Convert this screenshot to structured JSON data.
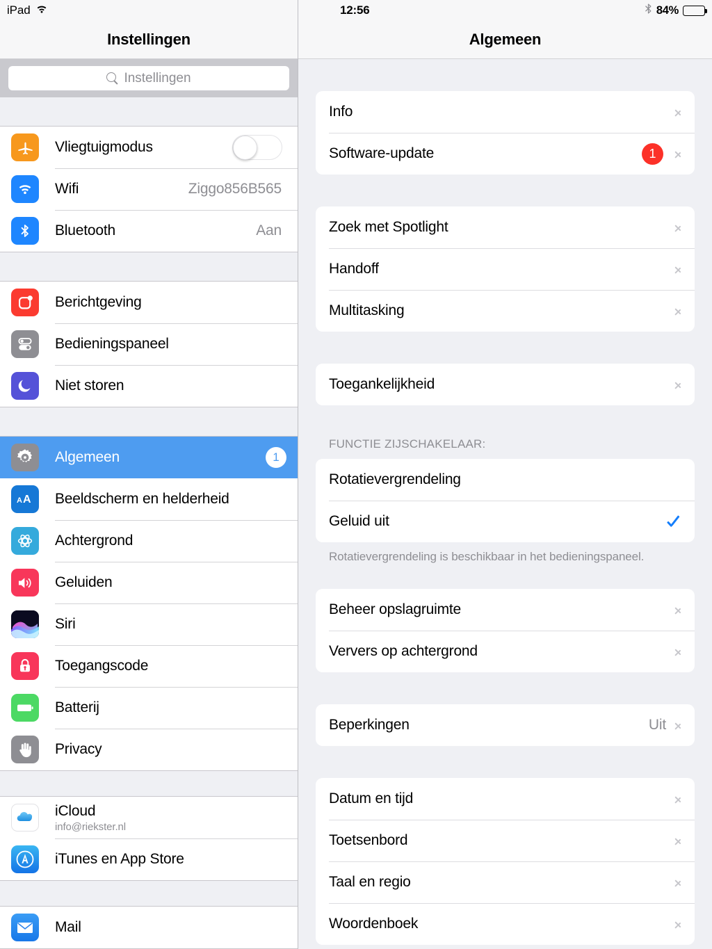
{
  "status_bar": {
    "device_label": "iPad",
    "wifi_icon": "wifi-icon",
    "time": "12:56",
    "bluetooth_icon": "bluetooth-icon",
    "battery_percent": "84%",
    "battery_level": 84
  },
  "sidebar": {
    "title": "Instellingen",
    "search": {
      "placeholder": "Instellingen",
      "value": "",
      "icon": "search-icon"
    },
    "groups": [
      {
        "items": [
          {
            "label": "Vliegtuigmodus",
            "icon": "airplane-icon",
            "control": "toggle",
            "toggle_on": false
          },
          {
            "label": "Wifi",
            "icon": "wifi-icon",
            "value": "Ziggo856B565"
          },
          {
            "label": "Bluetooth",
            "icon": "bluetooth-icon",
            "value": "Aan"
          }
        ]
      },
      {
        "items": [
          {
            "label": "Berichtgeving",
            "icon": "notifications-icon"
          },
          {
            "label": "Bedieningspaneel",
            "icon": "control-center-icon"
          },
          {
            "label": "Niet storen",
            "icon": "do-not-disturb-icon"
          }
        ]
      },
      {
        "items": [
          {
            "label": "Algemeen",
            "icon": "gear-icon",
            "selected": true,
            "badge": "1"
          },
          {
            "label": "Beeldscherm en helderheid",
            "icon": "display-brightness-icon"
          },
          {
            "label": "Achtergrond",
            "icon": "wallpaper-icon"
          },
          {
            "label": "Geluiden",
            "icon": "sounds-icon"
          },
          {
            "label": "Siri",
            "icon": "siri-icon"
          },
          {
            "label": "Toegangscode",
            "icon": "passcode-lock-icon"
          },
          {
            "label": "Batterij",
            "icon": "battery-icon"
          },
          {
            "label": "Privacy",
            "icon": "privacy-hand-icon"
          }
        ]
      },
      {
        "items": [
          {
            "label": "iCloud",
            "sublabel": "info@riekster.nl",
            "icon": "icloud-icon"
          },
          {
            "label": "iTunes en App Store",
            "icon": "app-store-icon"
          }
        ]
      },
      {
        "items": [
          {
            "label": "Mail",
            "icon": "mail-icon"
          }
        ]
      }
    ]
  },
  "detail": {
    "title": "Algemeen",
    "sections": [
      {
        "rows": [
          {
            "label": "Info",
            "accessory": "chevron"
          },
          {
            "label": "Software-update",
            "badge": "1",
            "accessory": "chevron"
          }
        ]
      },
      {
        "rows": [
          {
            "label": "Zoek met Spotlight",
            "accessory": "chevron"
          },
          {
            "label": "Handoff",
            "accessory": "chevron"
          },
          {
            "label": "Multitasking",
            "accessory": "chevron"
          }
        ]
      },
      {
        "rows": [
          {
            "label": "Toegankelijkheid",
            "accessory": "chevron"
          }
        ]
      },
      {
        "header": "FUNCTIE ZIJSCHAKELAAR:",
        "footnote": "Rotatievergrendeling is beschikbaar in het bedieningspaneel.",
        "rows": [
          {
            "label": "Rotatievergrendeling",
            "accessory": "none"
          },
          {
            "label": "Geluid uit",
            "accessory": "check"
          }
        ]
      },
      {
        "rows": [
          {
            "label": "Beheer opslagruimte",
            "accessory": "chevron"
          },
          {
            "label": "Ververs op achtergrond",
            "accessory": "chevron"
          }
        ]
      },
      {
        "rows": [
          {
            "label": "Beperkingen",
            "value": "Uit",
            "accessory": "chevron"
          }
        ]
      },
      {
        "rows": [
          {
            "label": "Datum en tijd",
            "accessory": "chevron"
          },
          {
            "label": "Toetsenbord",
            "accessory": "chevron"
          },
          {
            "label": "Taal en regio",
            "accessory": "chevron"
          },
          {
            "label": "Woordenboek",
            "accessory": "chevron"
          }
        ]
      }
    ]
  },
  "colors": {
    "selection_blue": "#4e9cf0",
    "badge_red": "#fc3128",
    "accent_blue": "#147efb",
    "background": "#eff0f4",
    "secondary_text": "#8e8e93"
  }
}
